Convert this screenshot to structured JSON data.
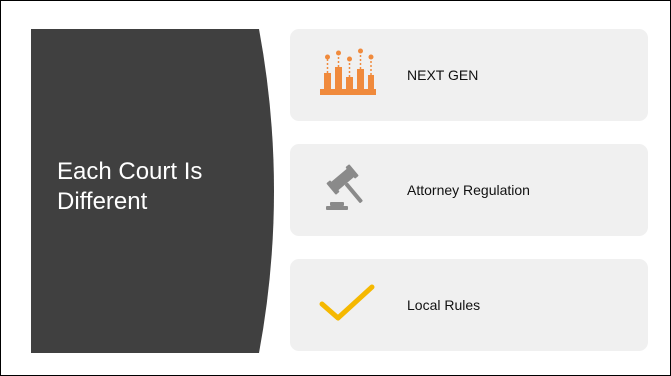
{
  "slide": {
    "title": "Each Court Is\nDifferent",
    "panel_color": "#404040"
  },
  "cards": [
    {
      "label": "NEXT GEN",
      "icon": "thermometer-chart-icon",
      "icon_color": "#f08a3c"
    },
    {
      "label": "Attorney Regulation",
      "icon": "gavel-icon",
      "icon_color": "#8a8a8a"
    },
    {
      "label": "Local Rules",
      "icon": "checkmark-icon",
      "icon_color": "#f5b800"
    }
  ]
}
